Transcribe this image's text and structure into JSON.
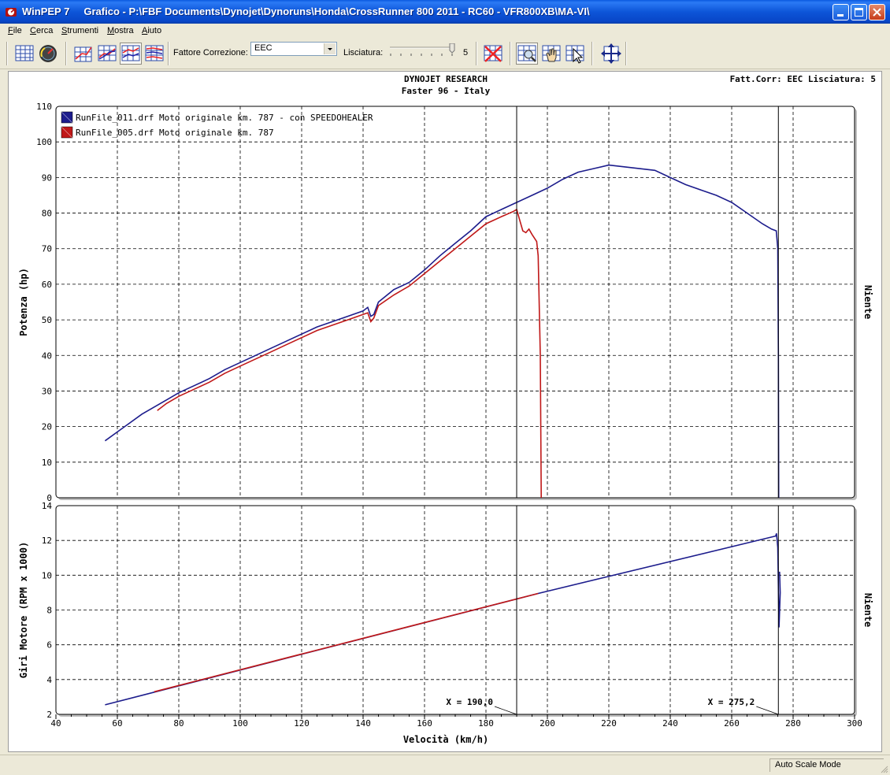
{
  "window": {
    "title": "WinPEP 7     Grafico - P:\\FBF Documents\\Dynojet\\Dynoruns\\Honda\\CrossRunner 800 2011 - RC60 - VFR800XB\\MA-VI\\"
  },
  "menu": {
    "file": "F",
    "file_rest": "ile",
    "cerca": "C",
    "cerca_rest": "erca",
    "strumenti": "S",
    "strumenti_rest": "trumenti",
    "mostra": "M",
    "mostra_rest": "ostra",
    "aiuto": "A",
    "aiuto_rest": "iuto"
  },
  "toolbar": {
    "fattore_label": "Fattore Correzione:",
    "fattore_value": "EEC",
    "lisciatura_label": "Lisciatura:",
    "lisciatura_value": "5"
  },
  "header": {
    "line1": "DYNOJET RESEARCH",
    "line2": "Faster 96 - Italy",
    "right": "Fatt.Corr: EEC  Lisciatura: 5"
  },
  "cursors": {
    "a_label": "X = 190,0",
    "b_label": "X = 275,2",
    "a_x": 190.0,
    "b_x": 275.2
  },
  "status": {
    "mode": "Auto Scale Mode"
  },
  "colors": {
    "blue": "#1c1c8c",
    "red": "#c01818",
    "grid": "#000000"
  },
  "chart_data": [
    {
      "type": "line",
      "title": "",
      "xlabel": "Velocità (km/h)",
      "ylabel": "Potenza (hp)",
      "right_label": "Niente",
      "xlim": [
        40,
        300
      ],
      "ylim": [
        0,
        110
      ],
      "x_ticks": [
        "40",
        "60",
        "80",
        "100",
        "120",
        "140",
        "160",
        "180",
        "200",
        "220",
        "240",
        "260",
        "280",
        "300"
      ],
      "y_ticks": [
        "0",
        "10",
        "20",
        "30",
        "40",
        "50",
        "60",
        "70",
        "80",
        "90",
        "100",
        "110"
      ],
      "grid": true,
      "legend_position": "top-left",
      "series": [
        {
          "name": "RunFile_011.drf Moto originale km. 787 - con SPEEDOHEALER",
          "color": "#1c1c8c",
          "points": [
            [
              56,
              16
            ],
            [
              60,
              18.5
            ],
            [
              64,
              21
            ],
            [
              68,
              23.5
            ],
            [
              72,
              25.5
            ],
            [
              76,
              27.5
            ],
            [
              80,
              29.5
            ],
            [
              85,
              31.5
            ],
            [
              90,
              33.5
            ],
            [
              95,
              36
            ],
            [
              100,
              38
            ],
            [
              105,
              40
            ],
            [
              110,
              42
            ],
            [
              115,
              44
            ],
            [
              120,
              46
            ],
            [
              125,
              48
            ],
            [
              130,
              49.5
            ],
            [
              135,
              51
            ],
            [
              140,
              52.5
            ],
            [
              141.5,
              53.5
            ],
            [
              142.5,
              51
            ],
            [
              143.5,
              51.5
            ],
            [
              145,
              55
            ],
            [
              150,
              58.5
            ],
            [
              155,
              60.5
            ],
            [
              160,
              64
            ],
            [
              165,
              68
            ],
            [
              170,
              71.5
            ],
            [
              175,
              75
            ],
            [
              180,
              79
            ],
            [
              185,
              81
            ],
            [
              190,
              83
            ],
            [
              195,
              85
            ],
            [
              200,
              87
            ],
            [
              205,
              89.5
            ],
            [
              210,
              91.5
            ],
            [
              215,
              92.5
            ],
            [
              220,
              93.5
            ],
            [
              225,
              93
            ],
            [
              230,
              92.5
            ],
            [
              235,
              92
            ],
            [
              240,
              90
            ],
            [
              245,
              88
            ],
            [
              250,
              86.5
            ],
            [
              255,
              85
            ],
            [
              260,
              83
            ],
            [
              265,
              80
            ],
            [
              270,
              77
            ],
            [
              273,
              75.5
            ],
            [
              274.5,
              75
            ],
            [
              275,
              70
            ],
            [
              275.2,
              40
            ],
            [
              275.3,
              0
            ]
          ]
        },
        {
          "name": "RunFile_005.drf Moto originale km. 787",
          "color": "#c01818",
          "points": [
            [
              73,
              24.5
            ],
            [
              76,
              26.5
            ],
            [
              80,
              28.5
            ],
            [
              85,
              30.5
            ],
            [
              90,
              32.5
            ],
            [
              95,
              35
            ],
            [
              100,
              37
            ],
            [
              105,
              39
            ],
            [
              110,
              41
            ],
            [
              115,
              43
            ],
            [
              120,
              45
            ],
            [
              125,
              47
            ],
            [
              130,
              48.5
            ],
            [
              135,
              50
            ],
            [
              140,
              51.5
            ],
            [
              141.5,
              52
            ],
            [
              142.5,
              49.5
            ],
            [
              143.5,
              50.5
            ],
            [
              145,
              54
            ],
            [
              150,
              57
            ],
            [
              155,
              59.5
            ],
            [
              160,
              63
            ],
            [
              165,
              66.5
            ],
            [
              170,
              70
            ],
            [
              175,
              73.5
            ],
            [
              180,
              77
            ],
            [
              185,
              79
            ],
            [
              189,
              80.5
            ],
            [
              190,
              81
            ],
            [
              191,
              78
            ],
            [
              192,
              75
            ],
            [
              193,
              74.5
            ],
            [
              194,
              75.5
            ],
            [
              195,
              74
            ],
            [
              196.5,
              72
            ],
            [
              197,
              68
            ],
            [
              197.7,
              40
            ],
            [
              198,
              0
            ]
          ]
        }
      ]
    },
    {
      "type": "line",
      "title": "",
      "xlabel": "Velocità (km/h)",
      "ylabel": "Giri Motore (RPM x 1000)",
      "right_label": "Niente",
      "xlim": [
        40,
        300
      ],
      "ylim": [
        2,
        14
      ],
      "x_ticks": [
        "40",
        "60",
        "80",
        "100",
        "120",
        "140",
        "160",
        "180",
        "200",
        "220",
        "240",
        "260",
        "280",
        "300"
      ],
      "y_ticks": [
        "2",
        "4",
        "6",
        "8",
        "10",
        "12",
        "14"
      ],
      "grid": true,
      "series": [
        {
          "color": "#1c1c8c",
          "points": [
            [
              56,
              2.55
            ],
            [
              197,
              8.95
            ],
            [
              274.3,
              12.25
            ],
            [
              274.6,
              12.4
            ],
            [
              275.0,
              11.6
            ],
            [
              275.4,
              7.0
            ],
            [
              275.8,
              9.0
            ],
            [
              275.6,
              10.2
            ]
          ]
        },
        {
          "color": "#c01818",
          "points": [
            [
              72,
              3.3
            ],
            [
              197,
              8.95
            ]
          ]
        }
      ]
    }
  ]
}
